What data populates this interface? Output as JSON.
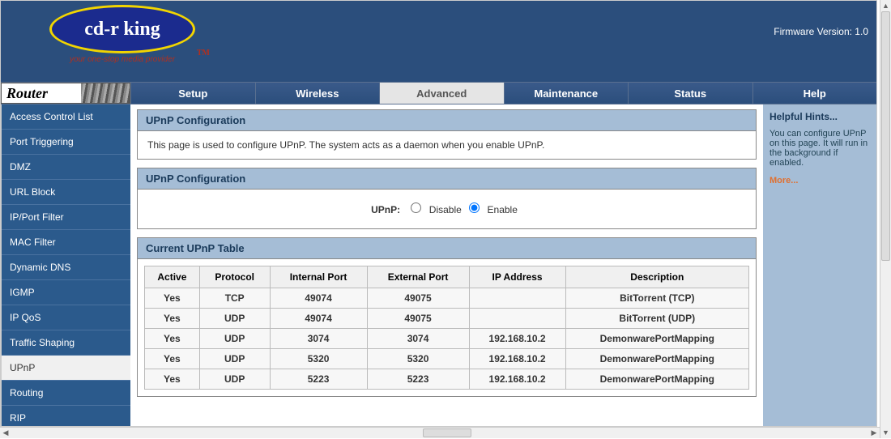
{
  "header": {
    "logo_text": "cd-r king",
    "logo_tm": "TM",
    "tagline": "your one-stop media provider",
    "firmware": "Firmware Version: 1.0"
  },
  "topnav": {
    "router_label": "Router",
    "tabs": [
      "Setup",
      "Wireless",
      "Advanced",
      "Maintenance",
      "Status",
      "Help"
    ],
    "active": "Advanced"
  },
  "sidebar": {
    "items": [
      "Access Control List",
      "Port Triggering",
      "DMZ",
      "URL Block",
      "IP/Port Filter",
      "MAC Filter",
      "Dynamic DNS",
      "IGMP",
      "IP QoS",
      "Traffic Shaping",
      "UPnP",
      "Routing",
      "RIP"
    ],
    "active": "UPnP"
  },
  "panels": {
    "intro_title": "UPnP Configuration",
    "intro_text": "This page is used to configure UPnP. The system acts as a daemon when you enable UPnP.",
    "config_title": "UPnP Configuration",
    "upnp_label": "UPnP:",
    "disable_label": "Disable",
    "enable_label": "Enable",
    "upnp_enabled": true,
    "table_title": "Current UPnP Table",
    "columns": [
      "Active",
      "Protocol",
      "Internal Port",
      "External Port",
      "IP Address",
      "Description"
    ],
    "rows": [
      {
        "active": "Yes",
        "protocol": "TCP",
        "iport": "49074",
        "eport": "49075",
        "ip": "",
        "desc": "BitTorrent (TCP)"
      },
      {
        "active": "Yes",
        "protocol": "UDP",
        "iport": "49074",
        "eport": "49075",
        "ip": "",
        "desc": "BitTorrent (UDP)"
      },
      {
        "active": "Yes",
        "protocol": "UDP",
        "iport": "3074",
        "eport": "3074",
        "ip": "192.168.10.2",
        "desc": "DemonwarePortMapping"
      },
      {
        "active": "Yes",
        "protocol": "UDP",
        "iport": "5320",
        "eport": "5320",
        "ip": "192.168.10.2",
        "desc": "DemonwarePortMapping"
      },
      {
        "active": "Yes",
        "protocol": "UDP",
        "iport": "5223",
        "eport": "5223",
        "ip": "192.168.10.2",
        "desc": "DemonwarePortMapping"
      }
    ]
  },
  "hints": {
    "title": "Helpful Hints...",
    "text": "You can configure UPnP on this page. It will run in the background if enabled.",
    "more": "More..."
  }
}
